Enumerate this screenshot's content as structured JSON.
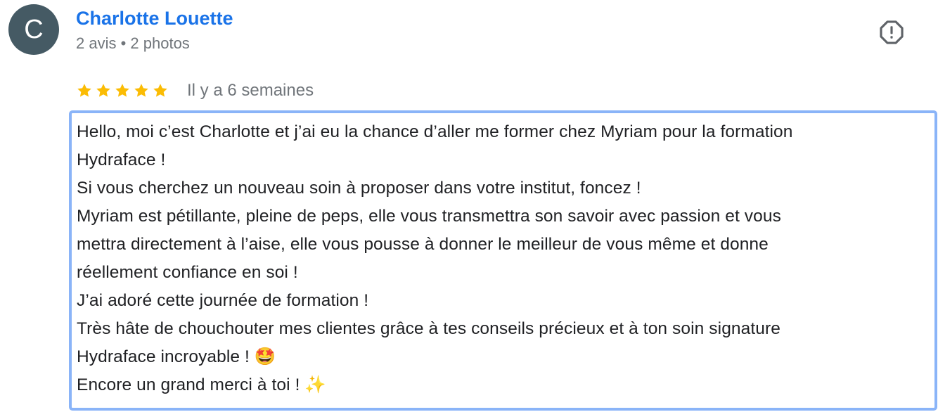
{
  "reviewer": {
    "avatar_initial": "C",
    "avatar_color": "#455a64",
    "name": "Charlotte Louette",
    "meta": "2 avis • 2 photos"
  },
  "report_icon": "report-flag-octagon-icon",
  "rating": {
    "stars": 5,
    "max_stars": 5,
    "star_color": "#fbbc04",
    "date": "Il y a 6 semaines"
  },
  "review_text": {
    "lines": [
      "Hello, moi c’est Charlotte et j’ai eu la chance d’aller me former chez Myriam pour la formation",
      "Hydraface !",
      "Si vous cherchez un nouveau soin à proposer dans votre institut, foncez !",
      "Myriam est pétillante, pleine de peps, elle vous transmettra son savoir avec passion et vous",
      "mettra directement à l’aise, elle vous pousse à donner le meilleur de vous même et donne",
      "réellement confiance en soi !",
      "J’ai adoré cette journée de formation !",
      "Très hâte de chouchouter mes clientes grâce à tes conseils précieux et à ton soin signature",
      "Hydraface incroyable ! 🤩",
      "Encore un grand merci à toi ! ✨"
    ]
  },
  "colors": {
    "name_link": "#1a73e8",
    "secondary_text": "#70757a",
    "selection_border": "#8ab4f8"
  }
}
